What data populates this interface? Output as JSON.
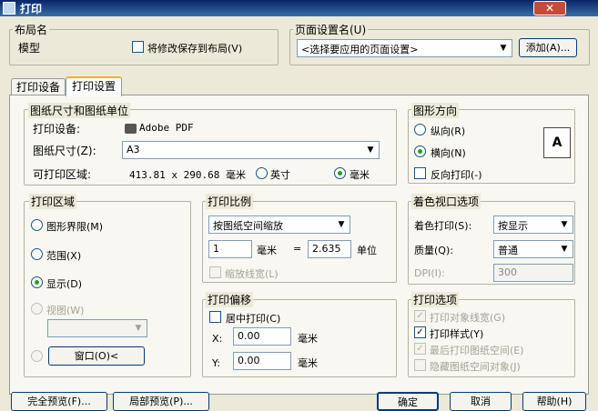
{
  "window": {
    "title": "打印",
    "close_label": "✕"
  },
  "layout_group": {
    "label": "布局名",
    "layout_name": "模型",
    "save_checkbox_label": "将修改保存到布局(V)",
    "save_checked": false
  },
  "page_setup": {
    "label": "页面设置名(U)",
    "combo_value": "<选择要应用的页面设置>",
    "add_button": "添加(A)..."
  },
  "tabs": [
    {
      "label": "打印设备",
      "active": false
    },
    {
      "label": "打印设置",
      "active": true
    }
  ],
  "paper": {
    "group_label": "图纸尺寸和图纸单位",
    "device_label": "打印设备:",
    "device_value": "Adobe PDF",
    "size_label": "图纸尺寸(Z):",
    "size_value": "A3",
    "printable_label": "可打印区域:",
    "printable_value": "413.81 x 290.68 毫米",
    "unit_inch": "英寸",
    "unit_mm": "毫米",
    "selected_unit": "毫米"
  },
  "orientation": {
    "group_label": "图形方向",
    "portrait": "纵向(R)",
    "landscape": "横向(N)",
    "selected": "横向(N)",
    "reverse_label": "反向打印(-)",
    "reverse_checked": false,
    "icon_glyph": "A"
  },
  "plot_area": {
    "group_label": "打印区域",
    "limits": "图形界限(M)",
    "extents": "范围(X)",
    "display": "显示(D)",
    "view": "视图(W)",
    "selected": "显示(D)",
    "view_combo": "",
    "window_button": "窗口(O)<"
  },
  "scale": {
    "group_label": "打印比例",
    "combo_value": "按图纸空间缩放",
    "value1": "1",
    "unit1": "毫米",
    "equals": "=",
    "value2": "2.635",
    "unit2": "单位",
    "lineweights_label": "缩放线宽(L)",
    "lineweights_checked": false
  },
  "offset": {
    "group_label": "打印偏移",
    "center_label": "居中打印(C)",
    "center_checked": false,
    "x_label": "X:",
    "x_value": "0.00",
    "x_unit": "毫米",
    "y_label": "Y:",
    "y_value": "0.00",
    "y_unit": "毫米"
  },
  "shade": {
    "group_label": "着色视口选项",
    "shade_label": "着色打印(S):",
    "shade_value": "按显示",
    "quality_label": "质量(Q):",
    "quality_value": "普通",
    "dpi_label": "DPI(I):",
    "dpi_value": "300"
  },
  "plot_options": {
    "group_label": "打印选项",
    "items": [
      {
        "label": "打印对象线宽(G)",
        "checked": true,
        "enabled": false
      },
      {
        "label": "打印样式(Y)",
        "checked": true,
        "enabled": true
      },
      {
        "label": "最后打印图纸空间(E)",
        "checked": true,
        "enabled": false
      },
      {
        "label": "隐藏图纸空间对象(J)",
        "checked": false,
        "enabled": false
      }
    ]
  },
  "buttons": {
    "full_preview": "完全预览(F)...",
    "partial_preview": "局部预览(P)...",
    "ok": "确定",
    "cancel": "取消",
    "help": "帮助(H)"
  },
  "icons": {
    "check_glyph": "✓",
    "dropdown_glyph": "▼"
  }
}
